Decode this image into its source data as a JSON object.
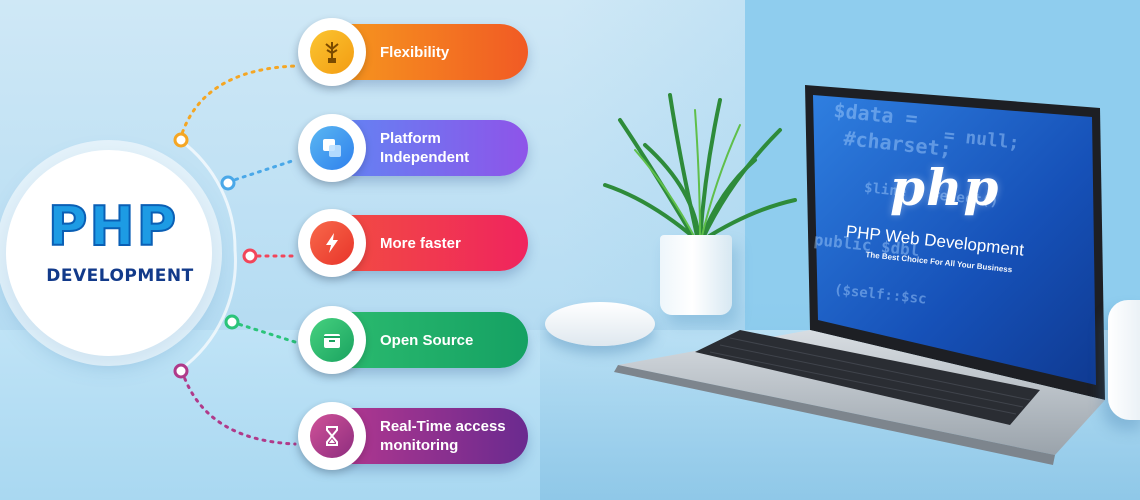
{
  "hub": {
    "title": "PHP",
    "subtitle": "DEVELOPMENT"
  },
  "features": [
    {
      "label": "Flexibility",
      "icon": "tree-icon",
      "color": "#f47a20"
    },
    {
      "label": "Platform Independent",
      "icon": "squares-icon",
      "color": "#7569ee"
    },
    {
      "label": "More faster",
      "icon": "lightning-icon",
      "color": "#f1384e"
    },
    {
      "label": "Open Source",
      "icon": "box-icon",
      "color": "#22b06a"
    },
    {
      "label": "Real-Time access monitoring",
      "icon": "hourglass-icon",
      "color": "#973388"
    }
  ],
  "laptop_screen": {
    "logo": "php",
    "title": "PHP Web Development",
    "tagline": "The Best Choice For All Your Business",
    "code_lines": [
      "$data =",
      "#charset;",
      "= null;",
      "$line = #exect()",
      "public $dbl",
      "($self::$sc"
    ]
  }
}
